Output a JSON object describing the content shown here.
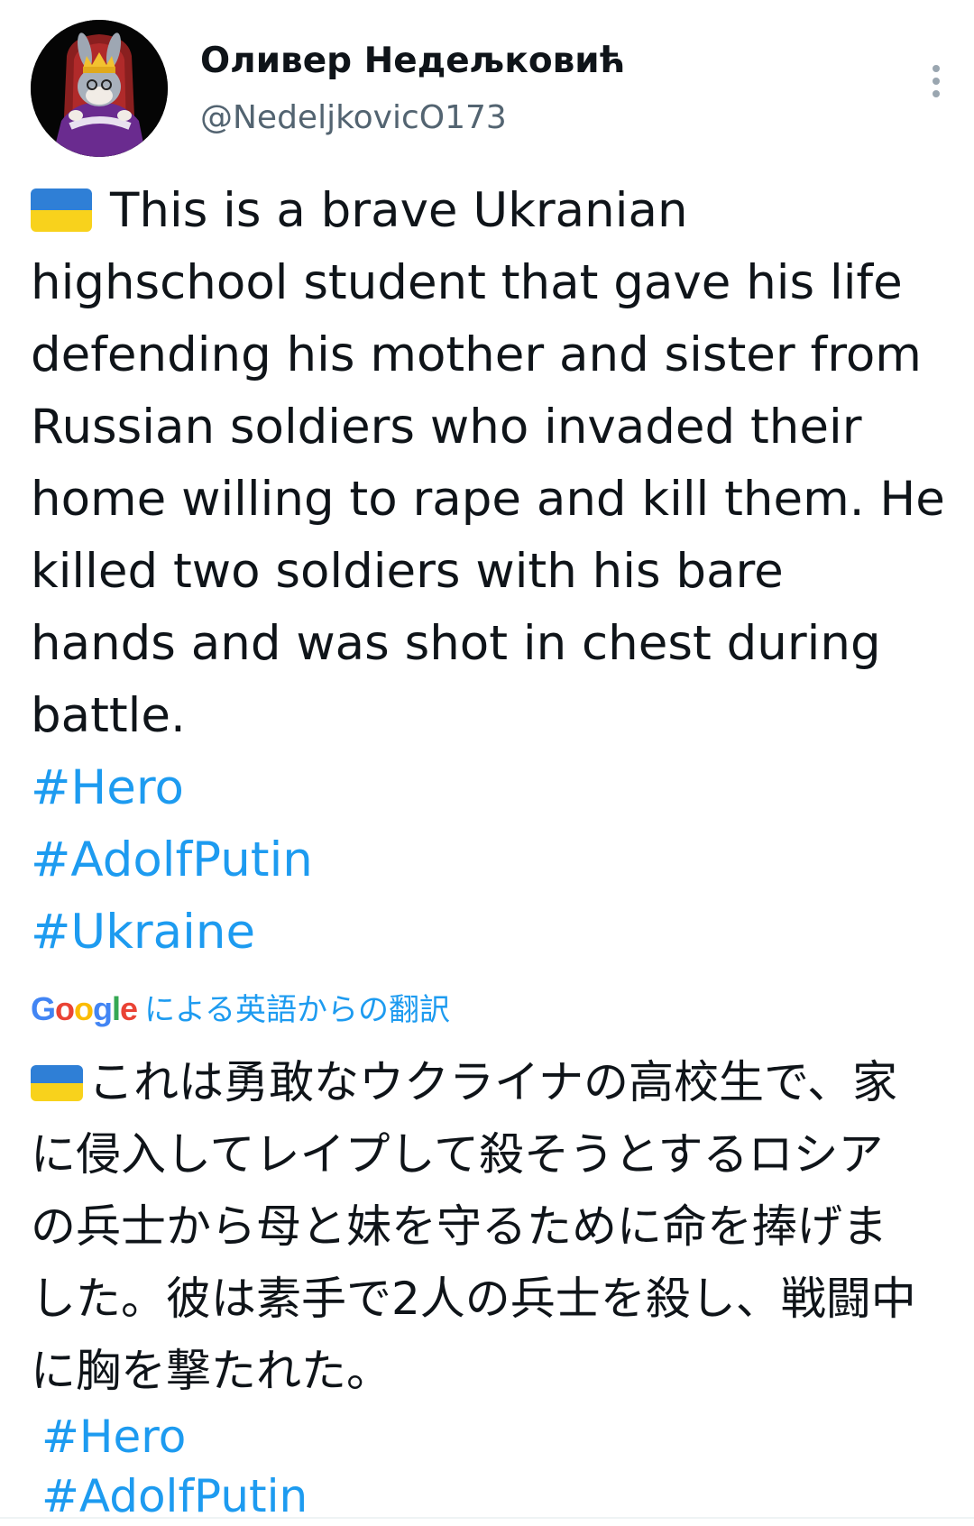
{
  "author": {
    "display_name": "Оливер Недељковић",
    "handle": "@NedeljkovicO173"
  },
  "tweet": {
    "flag_icon": "ukraine-flag-icon",
    "lines": [
      "This is a brave Ukranian",
      "highschool student that gave his life",
      "defending his mother and sister from",
      "Russian soldiers who invaded their",
      "home willing to rape and kill them. He",
      "killed two soldiers with his bare",
      "hands and was shot in chest during",
      "battle."
    ],
    "hashtags": [
      "#Hero",
      "#AdolfPutin",
      "#Ukraine"
    ]
  },
  "translation": {
    "provider_logo": "Google",
    "attribution": "による英語からの翻訳",
    "lines": [
      "これは勇敢なウクライナの高校生で、家",
      "に侵入してレイプして殺そうとするロシア",
      "の兵士から母と妹を守るために命を捧げま",
      "した。彼は素手で2人の兵士を殺し、戦闘中",
      "に胸を撃たれた。"
    ],
    "hashtags": [
      "#Hero",
      "#AdolfPutin"
    ]
  },
  "colors": {
    "link": "#1d9bf0",
    "text": "#0f1419",
    "secondary": "#536471",
    "flag_blue": "#2f7fd6",
    "flag_yellow": "#f8d21c"
  }
}
